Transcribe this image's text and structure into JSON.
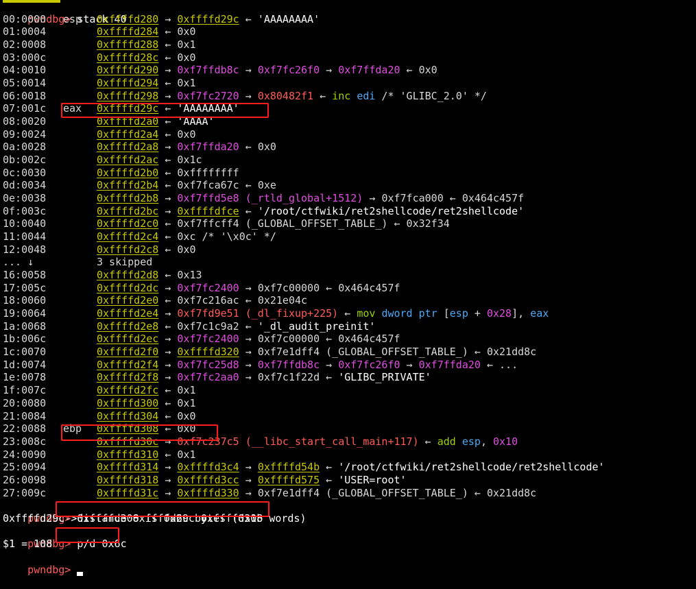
{
  "commands": {
    "stack_prompt": "pwndbg>",
    "stack_cmd": "stack 40",
    "distance_prompt": "pwndbg>",
    "distance_cmd": "distance 0xffffd29c 0xffffd308",
    "distance_out": "0xffffd29c->0xffffd308 is 0x6c bytes (0x1b words)",
    "pd_prompt": "pwndbg>",
    "pd_cmd": "p/d 0x6c",
    "pd_out": "$1 = 108",
    "last_prompt": "pwndbg>"
  },
  "stack_rows": [
    {
      "idx": "00:0000",
      "reg": "esp",
      "segs": [
        [
          "a",
          "0xffffd280"
        ],
        [
          "d",
          " → "
        ],
        [
          "a",
          "0xffffd29c"
        ],
        [
          "d",
          " ← "
        ],
        [
          "w",
          "'AAAAAAAA'"
        ]
      ]
    },
    {
      "idx": "01:0004",
      "reg": "",
      "segs": [
        [
          "a",
          "0xffffd284"
        ],
        [
          "d",
          " ← "
        ],
        [
          "d",
          "0x0"
        ]
      ]
    },
    {
      "idx": "02:0008",
      "reg": "",
      "segs": [
        [
          "a",
          "0xffffd288"
        ],
        [
          "d",
          " ← "
        ],
        [
          "d",
          "0x1"
        ]
      ]
    },
    {
      "idx": "03:000c",
      "reg": "",
      "segs": [
        [
          "a",
          "0xffffd28c"
        ],
        [
          "d",
          " ← "
        ],
        [
          "d",
          "0x0"
        ]
      ]
    },
    {
      "idx": "04:0010",
      "reg": "",
      "segs": [
        [
          "a",
          "0xffffd290"
        ],
        [
          "d",
          " → "
        ],
        [
          "m",
          "0xf7ffdb8c"
        ],
        [
          "d",
          " → "
        ],
        [
          "m",
          "0xf7fc26f0"
        ],
        [
          "d",
          " → "
        ],
        [
          "m",
          "0xf7ffda20"
        ],
        [
          "d",
          " ← "
        ],
        [
          "d",
          "0x0"
        ]
      ]
    },
    {
      "idx": "05:0014",
      "reg": "",
      "segs": [
        [
          "a",
          "0xffffd294"
        ],
        [
          "d",
          " ← "
        ],
        [
          "d",
          "0x1"
        ]
      ]
    },
    {
      "idx": "06:0018",
      "reg": "",
      "segs": [
        [
          "a",
          "0xffffd298"
        ],
        [
          "d",
          " → "
        ],
        [
          "m",
          "0xf7fc2720"
        ],
        [
          "d",
          " → "
        ],
        [
          "r",
          "0x80482f1"
        ],
        [
          "d",
          " ← "
        ],
        [
          "g",
          "inc"
        ],
        [
          "d",
          " "
        ],
        [
          "b",
          "edi"
        ],
        [
          "d",
          " /* 'GLIBC_2.0' */"
        ]
      ]
    },
    {
      "idx": "07:001c",
      "reg": "eax",
      "segs": [
        [
          "a",
          "0xffffd29c"
        ],
        [
          "d",
          " ← "
        ],
        [
          "w",
          "'AAAAAAAA'"
        ]
      ]
    },
    {
      "idx": "08:0020",
      "reg": "",
      "segs": [
        [
          "a",
          "0xffffd2a0"
        ],
        [
          "d",
          " ← "
        ],
        [
          "w",
          "'AAAA'"
        ]
      ]
    },
    {
      "idx": "09:0024",
      "reg": "",
      "segs": [
        [
          "a",
          "0xffffd2a4"
        ],
        [
          "d",
          " ← "
        ],
        [
          "d",
          "0x0"
        ]
      ]
    },
    {
      "idx": "0a:0028",
      "reg": "",
      "segs": [
        [
          "a",
          "0xffffd2a8"
        ],
        [
          "d",
          " → "
        ],
        [
          "m",
          "0xf7ffda20"
        ],
        [
          "d",
          " ← "
        ],
        [
          "d",
          "0x0"
        ]
      ]
    },
    {
      "idx": "0b:002c",
      "reg": "",
      "segs": [
        [
          "a",
          "0xffffd2ac"
        ],
        [
          "d",
          " ← "
        ],
        [
          "d",
          "0x1c"
        ]
      ]
    },
    {
      "idx": "0c:0030",
      "reg": "",
      "segs": [
        [
          "a",
          "0xffffd2b0"
        ],
        [
          "d",
          " ← "
        ],
        [
          "d",
          "0xffffffff"
        ]
      ]
    },
    {
      "idx": "0d:0034",
      "reg": "",
      "segs": [
        [
          "a",
          "0xffffd2b4"
        ],
        [
          "d",
          " ← "
        ],
        [
          "d",
          "0xf7fca67c"
        ],
        [
          "d",
          " ← "
        ],
        [
          "d",
          "0xe"
        ]
      ]
    },
    {
      "idx": "0e:0038",
      "reg": "",
      "segs": [
        [
          "a",
          "0xffffd2b8"
        ],
        [
          "d",
          " → "
        ],
        [
          "m",
          "0xf7ffd5e8"
        ],
        [
          "d",
          " "
        ],
        [
          "m",
          "(_rtld_global+1512)"
        ],
        [
          "d",
          " → "
        ],
        [
          "d",
          "0xf7fca000"
        ],
        [
          "d",
          " ← "
        ],
        [
          "d",
          "0x464c457f"
        ]
      ]
    },
    {
      "idx": "0f:003c",
      "reg": "",
      "segs": [
        [
          "a",
          "0xffffd2bc"
        ],
        [
          "d",
          " → "
        ],
        [
          "a",
          "0xffffdfce"
        ],
        [
          "d",
          " ← "
        ],
        [
          "w",
          "'/root/ctfwiki/ret2shellcode/ret2shellcode'"
        ]
      ]
    },
    {
      "idx": "10:0040",
      "reg": "",
      "segs": [
        [
          "a",
          "0xffffd2c0"
        ],
        [
          "d",
          " ← "
        ],
        [
          "d",
          "0xf7ffcff4 (_GLOBAL_OFFSET_TABLE_)"
        ],
        [
          "d",
          " ← "
        ],
        [
          "d",
          "0x32f34"
        ]
      ]
    },
    {
      "idx": "11:0044",
      "reg": "",
      "segs": [
        [
          "a",
          "0xffffd2c4"
        ],
        [
          "d",
          " ← "
        ],
        [
          "d",
          "0xc /* '\\x0c' */"
        ]
      ]
    },
    {
      "idx": "12:0048",
      "reg": "",
      "segs": [
        [
          "a",
          "0xffffd2c8"
        ],
        [
          "d",
          " ← "
        ],
        [
          "d",
          "0x0"
        ]
      ]
    },
    {
      "idx": "... ↓",
      "reg": "",
      "segs": [
        [
          "d",
          "3 skipped"
        ]
      ]
    },
    {
      "idx": "16:0058",
      "reg": "",
      "segs": [
        [
          "a",
          "0xffffd2d8"
        ],
        [
          "d",
          " ← "
        ],
        [
          "d",
          "0x13"
        ]
      ]
    },
    {
      "idx": "17:005c",
      "reg": "",
      "segs": [
        [
          "a",
          "0xffffd2dc"
        ],
        [
          "d",
          " → "
        ],
        [
          "m",
          "0xf7fc2400"
        ],
        [
          "d",
          " → "
        ],
        [
          "d",
          "0xf7c00000"
        ],
        [
          "d",
          " ← "
        ],
        [
          "d",
          "0x464c457f"
        ]
      ]
    },
    {
      "idx": "18:0060",
      "reg": "",
      "segs": [
        [
          "a",
          "0xffffd2e0"
        ],
        [
          "d",
          " ← "
        ],
        [
          "d",
          "0xf7c216ac"
        ],
        [
          "d",
          " ← "
        ],
        [
          "d",
          "0x21e04c"
        ]
      ]
    },
    {
      "idx": "19:0064",
      "reg": "",
      "segs": [
        [
          "a",
          "0xffffd2e4"
        ],
        [
          "d",
          " → "
        ],
        [
          "r",
          "0xf7fd9e51"
        ],
        [
          "d",
          " "
        ],
        [
          "r",
          "(_dl_fixup+225)"
        ],
        [
          "d",
          " ← "
        ],
        [
          "g",
          "mov"
        ],
        [
          "d",
          " "
        ],
        [
          "b",
          "dword ptr"
        ],
        [
          "d",
          " ["
        ],
        [
          "b",
          "esp"
        ],
        [
          "d",
          " + "
        ],
        [
          "m",
          "0x28"
        ],
        [
          "d",
          "], "
        ],
        [
          "b",
          "eax"
        ]
      ]
    },
    {
      "idx": "1a:0068",
      "reg": "",
      "segs": [
        [
          "a",
          "0xffffd2e8"
        ],
        [
          "d",
          " ← "
        ],
        [
          "d",
          "0xf7c1c9a2"
        ],
        [
          "d",
          " ← "
        ],
        [
          "w",
          "'_dl_audit_preinit'"
        ]
      ]
    },
    {
      "idx": "1b:006c",
      "reg": "",
      "segs": [
        [
          "a",
          "0xffffd2ec"
        ],
        [
          "d",
          " → "
        ],
        [
          "m",
          "0xf7fc2400"
        ],
        [
          "d",
          " → "
        ],
        [
          "d",
          "0xf7c00000"
        ],
        [
          "d",
          " ← "
        ],
        [
          "d",
          "0x464c457f"
        ]
      ]
    },
    {
      "idx": "1c:0070",
      "reg": "",
      "segs": [
        [
          "a",
          "0xffffd2f0"
        ],
        [
          "d",
          " → "
        ],
        [
          "a",
          "0xffffd320"
        ],
        [
          "d",
          " → "
        ],
        [
          "d",
          "0xf7e1dff4 (_GLOBAL_OFFSET_TABLE_)"
        ],
        [
          "d",
          " ← "
        ],
        [
          "d",
          "0x21dd8c"
        ]
      ]
    },
    {
      "idx": "1d:0074",
      "reg": "",
      "segs": [
        [
          "a",
          "0xffffd2f4"
        ],
        [
          "d",
          " → "
        ],
        [
          "m",
          "0xf7fc25d8"
        ],
        [
          "d",
          " → "
        ],
        [
          "m",
          "0xf7ffdb8c"
        ],
        [
          "d",
          " → "
        ],
        [
          "m",
          "0xf7fc26f0"
        ],
        [
          "d",
          " → "
        ],
        [
          "m",
          "0xf7ffda20"
        ],
        [
          "d",
          " ← ..."
        ]
      ]
    },
    {
      "idx": "1e:0078",
      "reg": "",
      "segs": [
        [
          "a",
          "0xffffd2f8"
        ],
        [
          "d",
          " → "
        ],
        [
          "m",
          "0xf7fc2aa0"
        ],
        [
          "d",
          " → "
        ],
        [
          "d",
          "0xf7c1f22d"
        ],
        [
          "d",
          " ← "
        ],
        [
          "w",
          "'GLIBC_PRIVATE'"
        ]
      ]
    },
    {
      "idx": "1f:007c",
      "reg": "",
      "segs": [
        [
          "a",
          "0xffffd2fc"
        ],
        [
          "d",
          " ← "
        ],
        [
          "d",
          "0x1"
        ]
      ]
    },
    {
      "idx": "20:0080",
      "reg": "",
      "segs": [
        [
          "a",
          "0xffffd300"
        ],
        [
          "d",
          " ← "
        ],
        [
          "d",
          "0x1"
        ]
      ]
    },
    {
      "idx": "21:0084",
      "reg": "",
      "segs": [
        [
          "a",
          "0xffffd304"
        ],
        [
          "d",
          " ← "
        ],
        [
          "d",
          "0x0"
        ]
      ]
    },
    {
      "idx": "22:0088",
      "reg": "ebp",
      "segs": [
        [
          "a",
          "0xffffd308"
        ],
        [
          "d",
          " ← "
        ],
        [
          "d",
          "0x0"
        ]
      ]
    },
    {
      "idx": "23:008c",
      "reg": "",
      "segs": [
        [
          "a",
          "0xffffd30c"
        ],
        [
          "d",
          " → "
        ],
        [
          "r",
          "0xf7c237c5"
        ],
        [
          "d",
          " "
        ],
        [
          "r",
          "(__libc_start_call_main+117)"
        ],
        [
          "d",
          " ← "
        ],
        [
          "g",
          "add"
        ],
        [
          "d",
          " "
        ],
        [
          "b",
          "esp"
        ],
        [
          "d",
          ", "
        ],
        [
          "m",
          "0x10"
        ]
      ]
    },
    {
      "idx": "24:0090",
      "reg": "",
      "segs": [
        [
          "a",
          "0xffffd310"
        ],
        [
          "d",
          " ← "
        ],
        [
          "d",
          "0x1"
        ]
      ]
    },
    {
      "idx": "25:0094",
      "reg": "",
      "segs": [
        [
          "a",
          "0xffffd314"
        ],
        [
          "d",
          " → "
        ],
        [
          "a",
          "0xffffd3c4"
        ],
        [
          "d",
          " → "
        ],
        [
          "a",
          "0xffffd54b"
        ],
        [
          "d",
          " ← "
        ],
        [
          "w",
          "'/root/ctfwiki/ret2shellcode/ret2shellcode'"
        ]
      ]
    },
    {
      "idx": "26:0098",
      "reg": "",
      "segs": [
        [
          "a",
          "0xffffd318"
        ],
        [
          "d",
          " → "
        ],
        [
          "a",
          "0xffffd3cc"
        ],
        [
          "d",
          " → "
        ],
        [
          "a",
          "0xffffd575"
        ],
        [
          "d",
          " ← "
        ],
        [
          "w",
          "'USER=root'"
        ]
      ]
    },
    {
      "idx": "27:009c",
      "reg": "",
      "segs": [
        [
          "a",
          "0xffffd31c"
        ],
        [
          "d",
          " → "
        ],
        [
          "a",
          "0xffffd330"
        ],
        [
          "d",
          " → "
        ],
        [
          "d",
          "0xf7e1dff4 (_GLOBAL_OFFSET_TABLE_)"
        ],
        [
          "d",
          " ← "
        ],
        [
          "d",
          "0x21dd8c"
        ]
      ]
    }
  ]
}
